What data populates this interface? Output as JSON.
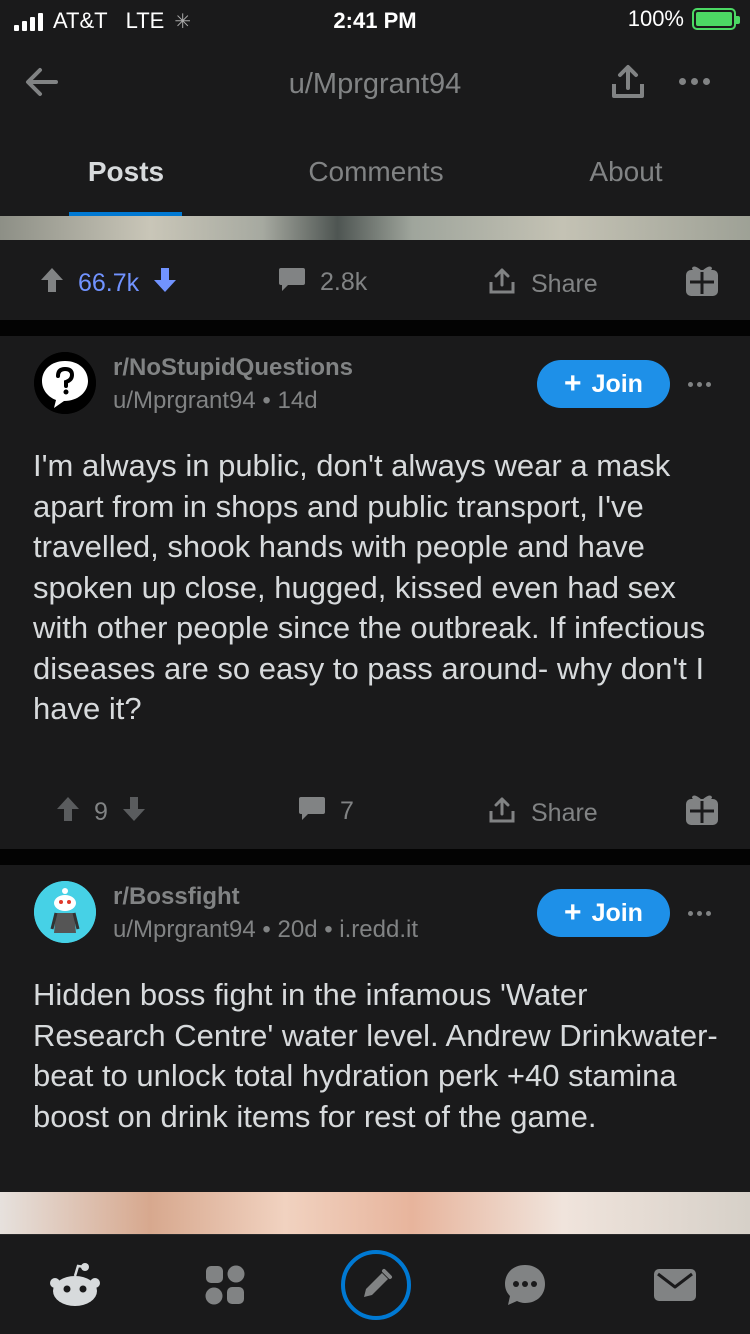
{
  "status_bar": {
    "carrier": "AT&T",
    "network": "LTE",
    "time": "2:41 PM",
    "battery": "100%"
  },
  "nav": {
    "title": "u/Mprgrant94"
  },
  "tabs": [
    {
      "label": "Posts",
      "active": true
    },
    {
      "label": "Comments",
      "active": false
    },
    {
      "label": "About",
      "active": false
    }
  ],
  "top_actions": {
    "votes": "66.7k",
    "comments": "2.8k",
    "share": "Share"
  },
  "posts": [
    {
      "subreddit": "r/NoStupidQuestions",
      "author": "u/Mprgrant94",
      "age": "14d",
      "join": "Join",
      "title": "I'm always in public, don't always wear a mask apart from in shops and public transport, I've travelled, shook hands with people and have spoken up close, hugged, kissed even had sex with other people since the outbreak. If infectious diseases are so easy to pass around- why don't I have it?",
      "votes": "9",
      "comments": "7",
      "share": "Share"
    },
    {
      "subreddit": "r/Bossfight",
      "author": "u/Mprgrant94",
      "age": "20d",
      "domain": "i.redd.it",
      "join": "Join",
      "title": "Hidden boss fight in the infamous 'Water Research Centre' water level. Andrew Drinkwater- beat to unlock total hydration perk +40 stamina boost on drink items for rest of the game."
    }
  ],
  "colors": {
    "accent": "#0079d3",
    "join": "#1e90e8",
    "upvoted": "#7193ff",
    "background": "#1a1a1b"
  }
}
